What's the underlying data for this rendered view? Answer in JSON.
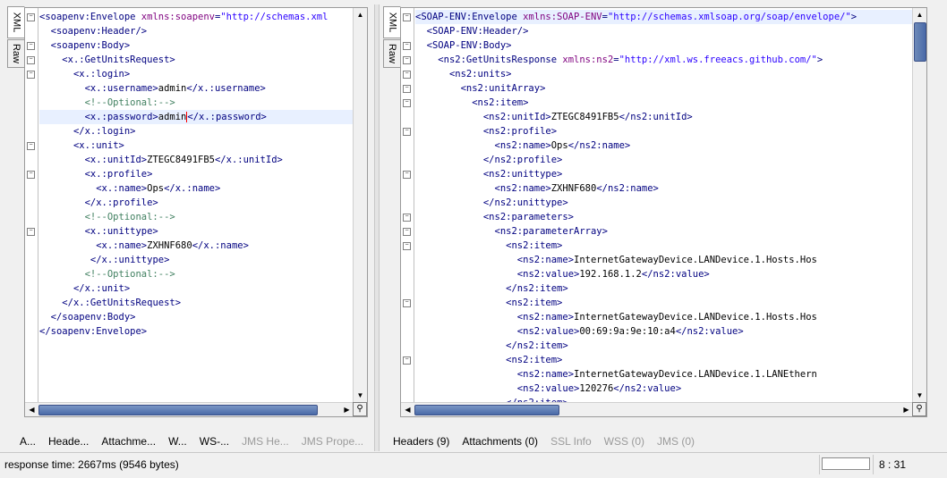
{
  "left": {
    "tabs_vertical": [
      "XML",
      "Raw"
    ],
    "bottom_tabs": [
      {
        "label": "A...",
        "enabled": true
      },
      {
        "label": "Heade...",
        "enabled": true
      },
      {
        "label": "Attachme...",
        "enabled": true
      },
      {
        "label": "W...",
        "enabled": true
      },
      {
        "label": "WS-...",
        "enabled": true
      },
      {
        "label": "JMS He...",
        "enabled": false
      },
      {
        "label": "JMS Prope...",
        "enabled": false
      }
    ],
    "lines": [
      {
        "fold": true,
        "indent": 0,
        "parts": [
          [
            "tag",
            "<soapenv:Envelope "
          ],
          [
            "attr",
            "xmlns:soapenv"
          ],
          [
            "tag",
            "="
          ],
          [
            "val",
            "\"http://schemas.xml"
          ]
        ]
      },
      {
        "fold": false,
        "indent": 2,
        "parts": [
          [
            "tag",
            "<soapenv:Header/>"
          ]
        ]
      },
      {
        "fold": true,
        "indent": 2,
        "parts": [
          [
            "tag",
            "<soapenv:Body>"
          ]
        ]
      },
      {
        "fold": true,
        "indent": 4,
        "parts": [
          [
            "tag",
            "<x.:GetUnitsRequest>"
          ]
        ]
      },
      {
        "fold": true,
        "indent": 6,
        "parts": [
          [
            "tag",
            "<x.:login>"
          ]
        ]
      },
      {
        "fold": false,
        "indent": 8,
        "parts": [
          [
            "tag",
            "<x.:username>"
          ],
          [
            "txt",
            "admin"
          ],
          [
            "tag",
            "</x.:username>"
          ]
        ]
      },
      {
        "fold": false,
        "indent": 8,
        "parts": [
          [
            "cmt",
            "<!--Optional:-->"
          ]
        ]
      },
      {
        "fold": false,
        "indent": 8,
        "hl": true,
        "cursor_after": 2,
        "parts": [
          [
            "tag",
            "<x.:password>"
          ],
          [
            "txt",
            "admin"
          ],
          [
            "tag",
            "</x.:password>"
          ]
        ]
      },
      {
        "fold": false,
        "indent": 6,
        "parts": [
          [
            "tag",
            "</x.:login>"
          ]
        ]
      },
      {
        "fold": true,
        "indent": 6,
        "parts": [
          [
            "tag",
            "<x.:unit>"
          ]
        ]
      },
      {
        "fold": false,
        "indent": 8,
        "parts": [
          [
            "tag",
            "<x.:unitId>"
          ],
          [
            "txt",
            "ZTEGC8491FB5"
          ],
          [
            "tag",
            "</x.:unitId>"
          ]
        ]
      },
      {
        "fold": true,
        "indent": 8,
        "parts": [
          [
            "tag",
            "<x.:profile>"
          ]
        ]
      },
      {
        "fold": false,
        "indent": 10,
        "parts": [
          [
            "tag",
            "<x.:name>"
          ],
          [
            "txt",
            "Ops"
          ],
          [
            "tag",
            "</x.:name>"
          ]
        ]
      },
      {
        "fold": false,
        "indent": 8,
        "parts": [
          [
            "tag",
            "</x.:profile>"
          ]
        ]
      },
      {
        "fold": false,
        "indent": 8,
        "parts": [
          [
            "cmt",
            "<!--Optional:-->"
          ]
        ]
      },
      {
        "fold": true,
        "indent": 8,
        "parts": [
          [
            "tag",
            "<x.:unittype>"
          ]
        ]
      },
      {
        "fold": false,
        "indent": 10,
        "parts": [
          [
            "tag",
            "<x.:name>"
          ],
          [
            "txt",
            "ZXHNF680"
          ],
          [
            "tag",
            "</x.:name>"
          ]
        ]
      },
      {
        "fold": false,
        "indent": 9,
        "parts": [
          [
            "tag",
            "</x.:unittype>"
          ]
        ]
      },
      {
        "fold": false,
        "indent": 8,
        "parts": [
          [
            "cmt",
            "<!--Optional:-->"
          ]
        ]
      },
      {
        "fold": false,
        "indent": 6,
        "parts": [
          [
            "tag",
            "</x.:unit>"
          ]
        ]
      },
      {
        "fold": false,
        "indent": 4,
        "parts": [
          [
            "tag",
            "</x.:GetUnitsRequest>"
          ]
        ]
      },
      {
        "fold": false,
        "indent": 2,
        "parts": [
          [
            "tag",
            "</soapenv:Body>"
          ]
        ]
      },
      {
        "fold": false,
        "indent": 0,
        "parts": [
          [
            "tag",
            "</soapenv:Envelope>"
          ]
        ]
      }
    ]
  },
  "right": {
    "tabs_vertical": [
      "XML",
      "Raw"
    ],
    "bottom_tabs": [
      {
        "label": "Headers (9)",
        "enabled": true
      },
      {
        "label": "Attachments (0)",
        "enabled": true
      },
      {
        "label": "SSL Info",
        "enabled": false
      },
      {
        "label": "WSS (0)",
        "enabled": false
      },
      {
        "label": "JMS (0)",
        "enabled": false
      }
    ],
    "lines": [
      {
        "fold": true,
        "indent": 0,
        "hl": true,
        "parts": [
          [
            "tag",
            "<SOAP-ENV:Envelope "
          ],
          [
            "attr",
            "xmlns:SOAP-ENV"
          ],
          [
            "tag",
            "="
          ],
          [
            "val",
            "\"http://schemas.xmlsoap.org/soap/envelope/\""
          ],
          [
            "tag",
            ">"
          ]
        ]
      },
      {
        "fold": false,
        "indent": 2,
        "parts": [
          [
            "tag",
            "<SOAP-ENV:Header/>"
          ]
        ]
      },
      {
        "fold": true,
        "indent": 2,
        "parts": [
          [
            "tag",
            "<SOAP-ENV:Body>"
          ]
        ]
      },
      {
        "fold": true,
        "indent": 4,
        "parts": [
          [
            "tag",
            "<ns2:GetUnitsResponse "
          ],
          [
            "attr",
            "xmlns:ns2"
          ],
          [
            "tag",
            "="
          ],
          [
            "val",
            "\"http://xml.ws.freeacs.github.com/\""
          ],
          [
            "tag",
            ">"
          ]
        ]
      },
      {
        "fold": true,
        "indent": 6,
        "parts": [
          [
            "tag",
            "<ns2:units>"
          ]
        ]
      },
      {
        "fold": true,
        "indent": 8,
        "parts": [
          [
            "tag",
            "<ns2:unitArray>"
          ]
        ]
      },
      {
        "fold": true,
        "indent": 10,
        "parts": [
          [
            "tag",
            "<ns2:item>"
          ]
        ]
      },
      {
        "fold": false,
        "indent": 12,
        "parts": [
          [
            "tag",
            "<ns2:unitId>"
          ],
          [
            "txt",
            "ZTEGC8491FB5"
          ],
          [
            "tag",
            "</ns2:unitId>"
          ]
        ]
      },
      {
        "fold": true,
        "indent": 12,
        "parts": [
          [
            "tag",
            "<ns2:profile>"
          ]
        ]
      },
      {
        "fold": false,
        "indent": 14,
        "parts": [
          [
            "tag",
            "<ns2:name>"
          ],
          [
            "txt",
            "Ops"
          ],
          [
            "tag",
            "</ns2:name>"
          ]
        ]
      },
      {
        "fold": false,
        "indent": 12,
        "parts": [
          [
            "tag",
            "</ns2:profile>"
          ]
        ]
      },
      {
        "fold": true,
        "indent": 12,
        "parts": [
          [
            "tag",
            "<ns2:unittype>"
          ]
        ]
      },
      {
        "fold": false,
        "indent": 14,
        "parts": [
          [
            "tag",
            "<ns2:name>"
          ],
          [
            "txt",
            "ZXHNF680"
          ],
          [
            "tag",
            "</ns2:name>"
          ]
        ]
      },
      {
        "fold": false,
        "indent": 12,
        "parts": [
          [
            "tag",
            "</ns2:unittype>"
          ]
        ]
      },
      {
        "fold": true,
        "indent": 12,
        "parts": [
          [
            "tag",
            "<ns2:parameters>"
          ]
        ]
      },
      {
        "fold": true,
        "indent": 14,
        "parts": [
          [
            "tag",
            "<ns2:parameterArray>"
          ]
        ]
      },
      {
        "fold": true,
        "indent": 16,
        "parts": [
          [
            "tag",
            "<ns2:item>"
          ]
        ]
      },
      {
        "fold": false,
        "indent": 18,
        "parts": [
          [
            "tag",
            "<ns2:name>"
          ],
          [
            "txt",
            "InternetGatewayDevice.LANDevice.1.Hosts.Hos"
          ]
        ]
      },
      {
        "fold": false,
        "indent": 18,
        "parts": [
          [
            "tag",
            "<ns2:value>"
          ],
          [
            "txt",
            "192.168.1.2"
          ],
          [
            "tag",
            "</ns2:value>"
          ]
        ]
      },
      {
        "fold": false,
        "indent": 16,
        "parts": [
          [
            "tag",
            "</ns2:item>"
          ]
        ]
      },
      {
        "fold": true,
        "indent": 16,
        "parts": [
          [
            "tag",
            "<ns2:item>"
          ]
        ]
      },
      {
        "fold": false,
        "indent": 18,
        "parts": [
          [
            "tag",
            "<ns2:name>"
          ],
          [
            "txt",
            "InternetGatewayDevice.LANDevice.1.Hosts.Hos"
          ]
        ]
      },
      {
        "fold": false,
        "indent": 18,
        "parts": [
          [
            "tag",
            "<ns2:value>"
          ],
          [
            "txt",
            "00:69:9a:9e:10:a4"
          ],
          [
            "tag",
            "</ns2:value>"
          ]
        ]
      },
      {
        "fold": false,
        "indent": 16,
        "parts": [
          [
            "tag",
            "</ns2:item>"
          ]
        ]
      },
      {
        "fold": true,
        "indent": 16,
        "parts": [
          [
            "tag",
            "<ns2:item>"
          ]
        ]
      },
      {
        "fold": false,
        "indent": 18,
        "parts": [
          [
            "tag",
            "<ns2:name>"
          ],
          [
            "txt",
            "InternetGatewayDevice.LANDevice.1.LANEthern"
          ]
        ]
      },
      {
        "fold": false,
        "indent": 18,
        "parts": [
          [
            "tag",
            "<ns2:value>"
          ],
          [
            "txt",
            "120276"
          ],
          [
            "tag",
            "</ns2:value>"
          ]
        ]
      },
      {
        "fold": false,
        "indent": 16,
        "parts": [
          [
            "tag",
            "</ns2:item>"
          ]
        ]
      }
    ]
  },
  "status": {
    "response_time": "response time: 2667ms (9546 bytes)",
    "cursor_position": "8 : 31"
  }
}
